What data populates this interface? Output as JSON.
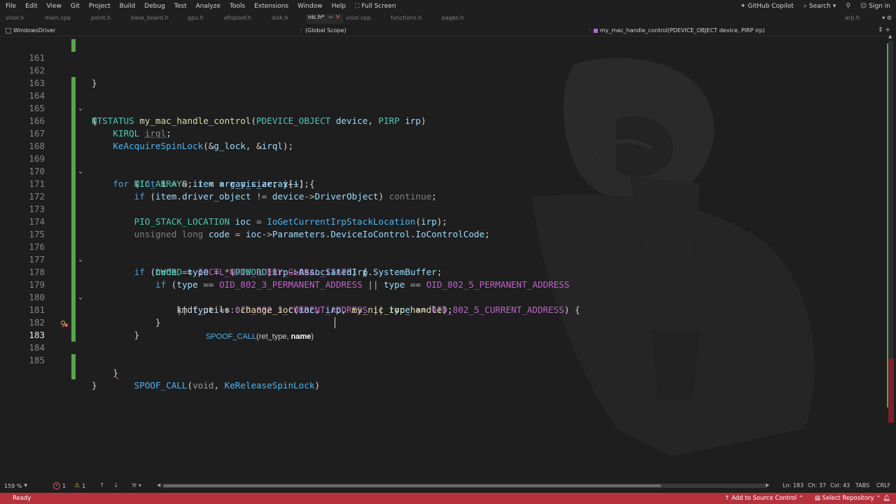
{
  "menubar": {
    "items": [
      "File",
      "Edit",
      "View",
      "Git",
      "Project",
      "Build",
      "Debug",
      "Test",
      "Analyze",
      "Tools",
      "Extensions",
      "Window",
      "Help"
    ],
    "fullscreen_label": "Full Screen",
    "copilot_label": "GitHub Copilot",
    "search_label": "Search",
    "signin_label": "Sign in"
  },
  "tabs": {
    "items": [
      "visor.h",
      "main.cpp",
      "point.h",
      "base_board.h",
      "gpu.h",
      "efispoof.h",
      "disk.h",
      "nic.h*",
      "visor.cpp",
      "functions.h",
      "pages.h"
    ],
    "active_index": 7,
    "right_tab": "arp.h"
  },
  "navbar": {
    "project": "WindowsDriver",
    "scope": "(Global Scope)",
    "function": "my_mac_handle_control(PDEVICE_OBJECT device, PIRP irp)"
  },
  "editor": {
    "current_line": 183,
    "signature_help": {
      "fn": "SPOOF_CALL",
      "open": "(",
      "param1": "ret_type, ",
      "param2": "name",
      "close": ")"
    },
    "lines": [
      {
        "n": "161"
      },
      {
        "n": "162"
      },
      {
        "n": "163"
      },
      {
        "n": "164"
      },
      {
        "n": "165"
      },
      {
        "n": "166"
      },
      {
        "n": "167"
      },
      {
        "n": "168"
      },
      {
        "n": "169"
      },
      {
        "n": "170"
      },
      {
        "n": "171"
      },
      {
        "n": "172"
      },
      {
        "n": "173"
      },
      {
        "n": "174"
      },
      {
        "n": "175"
      },
      {
        "n": "176"
      },
      {
        "n": "177"
      },
      {
        "n": "178"
      },
      {
        "n": "179"
      },
      {
        "n": "180"
      },
      {
        "n": "181"
      },
      {
        "n": "182"
      },
      {
        "n": "183"
      },
      {
        "n": "184"
      },
      {
        "n": "185"
      }
    ],
    "code": {
      "l161": "}",
      "l163_type": "NTSTATUS",
      "l163_fn": "my_mac_handle_control",
      "l163_p1t": "PDEVICE_OBJECT",
      "l163_p1": "device",
      "l163_p2t": "PIRP",
      "l163_p2": "irp",
      "l164": "{",
      "l165_type": "KIRQL",
      "l165_var": "irql",
      "l166_fn": "KeAcquireSpinLock",
      "l166_a1": "g_lock",
      "l166_a2": "irql",
      "l168_kw": "for",
      "l168_int": "int",
      "l168_i": "i",
      "l168_zero": "0",
      "l168_cond": "array_size",
      "l169_type": "NIC_ARRAY",
      "l169_var": "item",
      "l169_arr": "g_nic_array",
      "l170_kw": "if",
      "l170_obj": "item",
      "l170_field": "driver_object",
      "l170_dev": "device",
      "l170_dobj": "DriverObject",
      "l170_cont": "continue",
      "l172_type": "PIO_STACK_LOCATION",
      "l172_var": "ioc",
      "l172_fn": "IoGetCurrentIrpStackLocation",
      "l172_arg": "irp",
      "l173_kw": "unsigned long",
      "l173_var": "code",
      "l173_ioc": "ioc",
      "l173_f1": "Parameters",
      "l173_f2": "DeviceIoControl",
      "l173_f3": "IoControlCode",
      "l175_kw": "if",
      "l175_var": "code",
      "l175_mac": "IOCTL_NDIS_QUERY_GLOBAL_STATS",
      "l176_type": "DWORD",
      "l176_var": "type",
      "l176_cast": "PDWORD",
      "l176_irp": "irp",
      "l176_f1": "AssociatedIrp",
      "l176_f2": "SystemBuffer",
      "l177_kw": "if",
      "l177_var": "type",
      "l177_m1": "OID_802_3_PERMANENT_ADDRESS",
      "l177_m2": "OID_802_5_PERMANENT_ADDRESS",
      "l178_var": "type",
      "l178_m1": "OID_802_3_CURRENT_ADDRESS",
      "l178_m2": "OID_802_5_CURRENT_ADDRESS",
      "l179_ns": "kmdf_utils",
      "l179_fn": "change_ioc",
      "l179_a1": "ioc",
      "l179_a2": "irp",
      "l179_a3": "my_nic_ioc_handle",
      "l180": "}",
      "l181": "}",
      "l183_mac": "SPOOF_CALL",
      "l183_a1": "void",
      "l183_a2": "KeReleaseSpinLock",
      "l184": "}",
      "l185": "}"
    }
  },
  "edstatus": {
    "zoom": "159 %",
    "errors": "1",
    "warnings": "1",
    "ln": "Ln: 183",
    "ch": "Ch: 37",
    "col": "Col: 43",
    "tabs": "TABS",
    "eol": "CRLF"
  },
  "statusbar": {
    "ready": "Ready",
    "source_control": "Add to Source Control",
    "repository": "Select Repository"
  },
  "colors": {
    "accent_status": "#b5313c",
    "change_bar": "#57a64a",
    "background": "#1e1e1e"
  }
}
